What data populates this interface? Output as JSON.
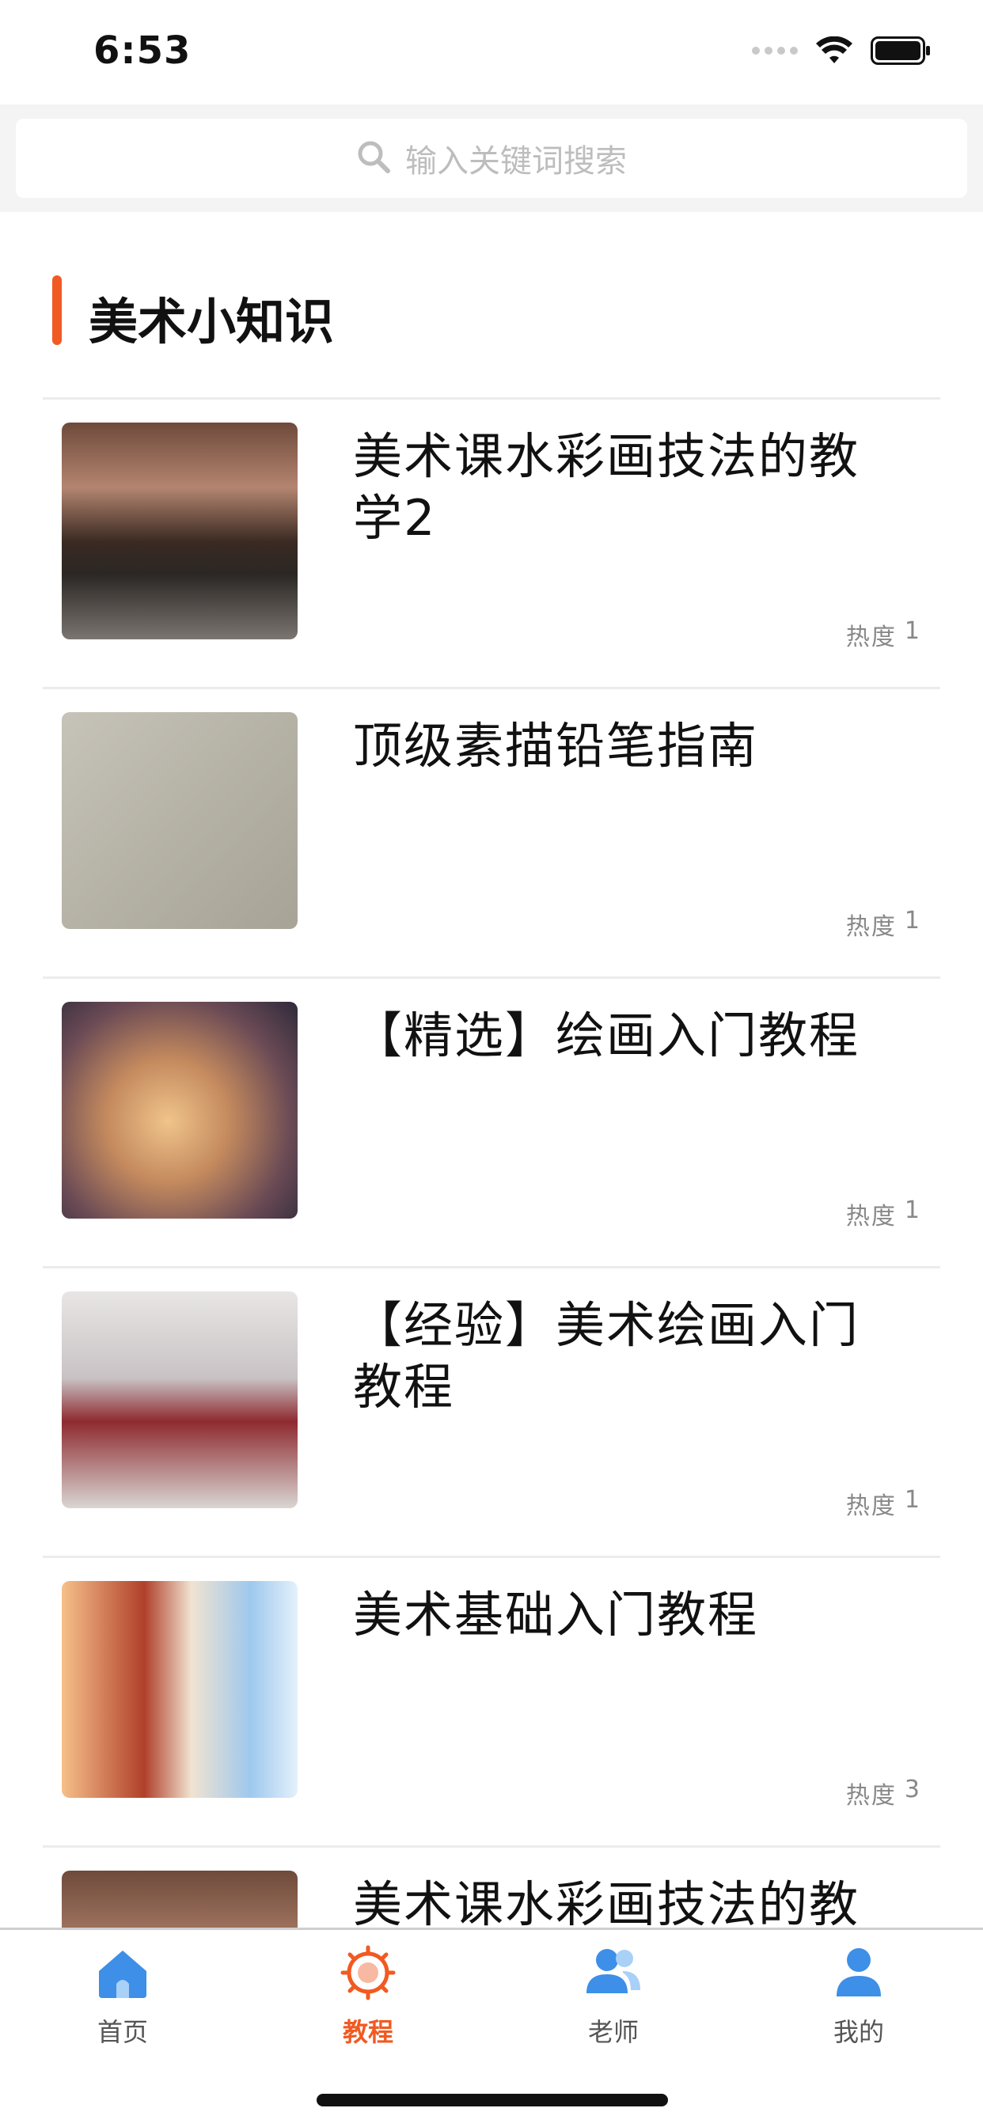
{
  "status_bar": {
    "time": "6:53"
  },
  "search": {
    "placeholder": "输入关键词搜索"
  },
  "section": {
    "title": "美术小知识"
  },
  "heat_label": "热度",
  "items": [
    {
      "title": "美术课水彩画技法的教学2",
      "heat": "1"
    },
    {
      "title": "顶级素描铅笔指南",
      "heat": "1"
    },
    {
      "title": "【精选】绘画入门教程",
      "heat": "1"
    },
    {
      "title": "【经验】美术绘画入门教程",
      "heat": "1"
    },
    {
      "title": "美术基础入门教程",
      "heat": "3"
    },
    {
      "title": "美术课水彩画技法的教"
    }
  ],
  "tabs": [
    {
      "label": "首页",
      "icon": "home-icon"
    },
    {
      "label": "教程",
      "icon": "tutorial-icon",
      "active": true
    },
    {
      "label": "老师",
      "icon": "teachers-icon"
    },
    {
      "label": "我的",
      "icon": "profile-icon"
    }
  ],
  "colors": {
    "accent": "#f15a22",
    "tab_icon_blue": "#3d8fe8"
  }
}
